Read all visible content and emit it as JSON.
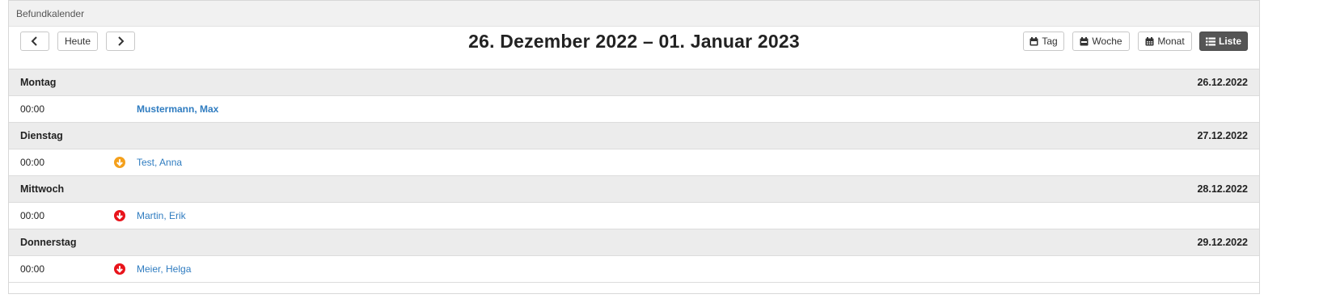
{
  "panel": {
    "title": "Befundkalender"
  },
  "toolbar": {
    "prev_icon": "chevron-left-icon",
    "today_label": "Heute",
    "next_icon": "chevron-right-icon",
    "range_title": "26. Dezember 2022 – 01. Januar 2023",
    "views": {
      "day": "Tag",
      "week": "Woche",
      "month": "Monat",
      "list": "Liste",
      "active": "list"
    }
  },
  "colors": {
    "link": "#2f7cc0",
    "status_orange": "#f4a01c",
    "status_red": "#e8141b",
    "active_button": "#555555"
  },
  "days": [
    {
      "weekday": "Montag",
      "date": "26.12.2022",
      "event": {
        "time": "00:00",
        "name": "Mustermann, Max",
        "bold": true,
        "status_icon": null
      }
    },
    {
      "weekday": "Dienstag",
      "date": "27.12.2022",
      "event": {
        "time": "00:00",
        "name": "Test, Anna",
        "bold": false,
        "status_icon": "arrow-down-circle-orange-icon"
      }
    },
    {
      "weekday": "Mittwoch",
      "date": "28.12.2022",
      "event": {
        "time": "00:00",
        "name": "Martin, Erik",
        "bold": false,
        "status_icon": "arrow-down-circle-red-icon"
      }
    },
    {
      "weekday": "Donnerstag",
      "date": "29.12.2022",
      "event": {
        "time": "00:00",
        "name": "Meier, Helga",
        "bold": false,
        "status_icon": "arrow-down-circle-red-icon"
      }
    }
  ]
}
